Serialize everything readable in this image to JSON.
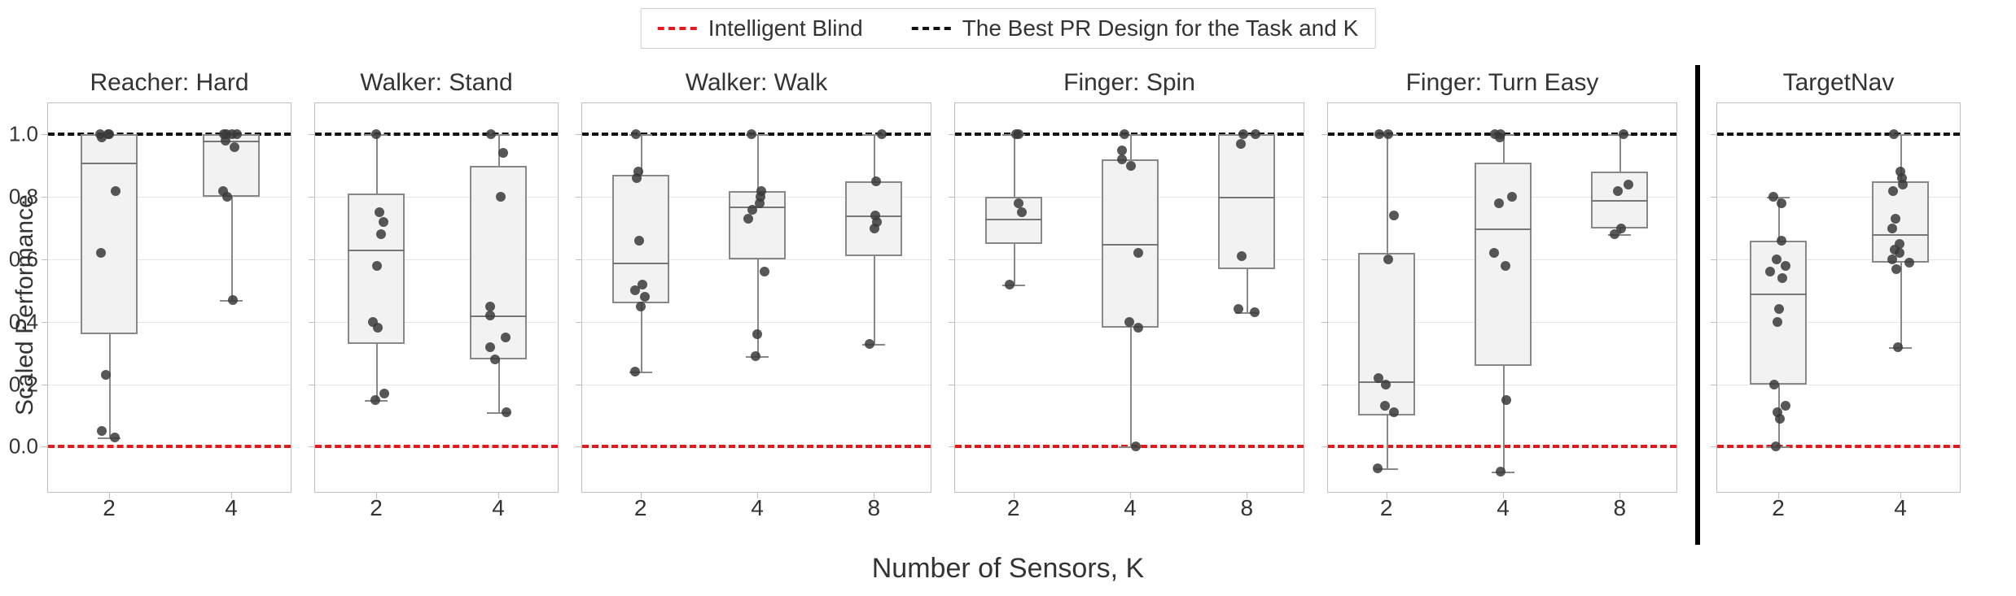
{
  "legend": {
    "blind": "Intelligent Blind",
    "best": "The Best PR Design for the Task and K"
  },
  "ylabel": "Scaled Performance",
  "xlabel": "Number of Sensors, K",
  "yticks": [
    0.0,
    0.2,
    0.4,
    0.6,
    0.8,
    1.0
  ],
  "ylim": [
    -0.15,
    1.1
  ],
  "ref_lines": {
    "black": 1.0,
    "red": 0.0
  },
  "panels": [
    {
      "title": "Reacher: Hard",
      "K": [
        2,
        4
      ],
      "boxes": [
        {
          "q1": 0.36,
          "med": 0.91,
          "q3": 1.0,
          "wlo": 0.03,
          "whi": 1.0
        },
        {
          "q1": 0.8,
          "med": 0.98,
          "q3": 1.0,
          "wlo": 0.47,
          "whi": 1.0
        }
      ],
      "points": [
        [
          0.03,
          0.05,
          0.23,
          0.62,
          0.82,
          0.99,
          1.0,
          1.0,
          1.0
        ],
        [
          0.47,
          0.8,
          0.82,
          0.96,
          0.98,
          1.0,
          1.0,
          1.0,
          1.0
        ]
      ]
    },
    {
      "title": "Walker: Stand",
      "K": [
        2,
        4
      ],
      "boxes": [
        {
          "q1": 0.33,
          "med": 0.63,
          "q3": 0.81,
          "wlo": 0.15,
          "whi": 1.0
        },
        {
          "q1": 0.28,
          "med": 0.42,
          "q3": 0.9,
          "wlo": 0.11,
          "whi": 1.0
        }
      ],
      "points": [
        [
          0.15,
          0.17,
          0.38,
          0.4,
          0.58,
          0.68,
          0.72,
          0.75,
          1.0
        ],
        [
          0.11,
          0.28,
          0.32,
          0.35,
          0.42,
          0.45,
          0.8,
          0.94,
          1.0
        ]
      ]
    },
    {
      "title": "Walker: Walk",
      "K": [
        2,
        4,
        8
      ],
      "boxes": [
        {
          "q1": 0.46,
          "med": 0.59,
          "q3": 0.87,
          "wlo": 0.24,
          "whi": 1.0
        },
        {
          "q1": 0.6,
          "med": 0.77,
          "q3": 0.82,
          "wlo": 0.29,
          "whi": 1.0
        },
        {
          "q1": 0.61,
          "med": 0.74,
          "q3": 0.85,
          "wlo": 0.33,
          "whi": 1.0
        }
      ],
      "points": [
        [
          0.24,
          0.45,
          0.48,
          0.5,
          0.52,
          0.66,
          0.86,
          0.88,
          1.0
        ],
        [
          0.29,
          0.36,
          0.56,
          0.73,
          0.76,
          0.78,
          0.8,
          0.82,
          1.0
        ],
        [
          0.33,
          0.7,
          0.72,
          0.74,
          0.85,
          1.0
        ]
      ]
    },
    {
      "title": "Finger: Spin",
      "K": [
        2,
        4,
        8
      ],
      "boxes": [
        {
          "q1": 0.65,
          "med": 0.73,
          "q3": 0.8,
          "wlo": 0.52,
          "whi": 1.0
        },
        {
          "q1": 0.38,
          "med": 0.65,
          "q3": 0.92,
          "wlo": 0.0,
          "whi": 1.0
        },
        {
          "q1": 0.57,
          "med": 0.8,
          "q3": 1.0,
          "wlo": 0.43,
          "whi": 1.0
        }
      ],
      "points": [
        [
          0.52,
          0.75,
          0.78,
          1.0,
          1.0
        ],
        [
          0.0,
          0.38,
          0.4,
          0.62,
          0.9,
          0.92,
          0.95,
          1.0
        ],
        [
          0.43,
          0.44,
          0.61,
          0.97,
          1.0,
          1.0
        ]
      ]
    },
    {
      "title": "Finger: Turn Easy",
      "K": [
        2,
        4,
        8
      ],
      "boxes": [
        {
          "q1": 0.1,
          "med": 0.21,
          "q3": 0.62,
          "wlo": -0.07,
          "whi": 1.0
        },
        {
          "q1": 0.26,
          "med": 0.7,
          "q3": 0.91,
          "wlo": -0.08,
          "whi": 1.0
        },
        {
          "q1": 0.7,
          "med": 0.79,
          "q3": 0.88,
          "wlo": 0.68,
          "whi": 1.0
        }
      ],
      "points": [
        [
          -0.07,
          0.11,
          0.13,
          0.2,
          0.22,
          0.6,
          0.74,
          1.0,
          1.0
        ],
        [
          -0.08,
          0.15,
          0.58,
          0.62,
          0.78,
          0.8,
          0.99,
          1.0,
          1.0
        ],
        [
          0.68,
          0.7,
          0.82,
          0.84,
          1.0
        ]
      ]
    },
    {
      "title": "TargetNav",
      "K": [
        2,
        4
      ],
      "boxes": [
        {
          "q1": 0.2,
          "med": 0.49,
          "q3": 0.66,
          "wlo": 0.0,
          "whi": 0.8
        },
        {
          "q1": 0.59,
          "med": 0.68,
          "q3": 0.85,
          "wlo": 0.32,
          "whi": 1.0
        }
      ],
      "points": [
        [
          0.0,
          0.09,
          0.11,
          0.13,
          0.2,
          0.4,
          0.44,
          0.54,
          0.56,
          0.58,
          0.6,
          0.66,
          0.78,
          0.8
        ],
        [
          0.32,
          0.57,
          0.59,
          0.6,
          0.62,
          0.63,
          0.65,
          0.7,
          0.73,
          0.82,
          0.84,
          0.86,
          0.88,
          1.0
        ]
      ]
    }
  ],
  "chart_data": {
    "type": "box",
    "ylabel": "Scaled Performance",
    "xlabel": "Number of Sensors, K",
    "ylim": [
      -0.15,
      1.1
    ],
    "reference_lines": [
      {
        "name": "Intelligent Blind",
        "y": 0.0,
        "color": "#e31a1c",
        "style": "dashed"
      },
      {
        "name": "The Best PR Design for the Task and K",
        "y": 1.0,
        "color": "#111111",
        "style": "dashed"
      }
    ],
    "facets": [
      {
        "title": "Reacher: Hard",
        "x": [
          2,
          4
        ],
        "series": [
          {
            "K": 2,
            "box": {
              "q1": 0.36,
              "median": 0.91,
              "q3": 1.0,
              "whisker_low": 0.03,
              "whisker_high": 1.0
            },
            "points": [
              0.03,
              0.05,
              0.23,
              0.62,
              0.82,
              0.99,
              1.0,
              1.0,
              1.0
            ]
          },
          {
            "K": 4,
            "box": {
              "q1": 0.8,
              "median": 0.98,
              "q3": 1.0,
              "whisker_low": 0.47,
              "whisker_high": 1.0
            },
            "points": [
              0.47,
              0.8,
              0.82,
              0.96,
              0.98,
              1.0,
              1.0,
              1.0,
              1.0
            ]
          }
        ]
      },
      {
        "title": "Walker: Stand",
        "x": [
          2,
          4
        ],
        "series": [
          {
            "K": 2,
            "box": {
              "q1": 0.33,
              "median": 0.63,
              "q3": 0.81,
              "whisker_low": 0.15,
              "whisker_high": 1.0
            },
            "points": [
              0.15,
              0.17,
              0.38,
              0.4,
              0.58,
              0.68,
              0.72,
              0.75,
              1.0
            ]
          },
          {
            "K": 4,
            "box": {
              "q1": 0.28,
              "median": 0.42,
              "q3": 0.9,
              "whisker_low": 0.11,
              "whisker_high": 1.0
            },
            "points": [
              0.11,
              0.28,
              0.32,
              0.35,
              0.42,
              0.45,
              0.8,
              0.94,
              1.0
            ]
          }
        ]
      },
      {
        "title": "Walker: Walk",
        "x": [
          2,
          4,
          8
        ],
        "series": [
          {
            "K": 2,
            "box": {
              "q1": 0.46,
              "median": 0.59,
              "q3": 0.87,
              "whisker_low": 0.24,
              "whisker_high": 1.0
            },
            "points": [
              0.24,
              0.45,
              0.48,
              0.5,
              0.52,
              0.66,
              0.86,
              0.88,
              1.0
            ]
          },
          {
            "K": 4,
            "box": {
              "q1": 0.6,
              "median": 0.77,
              "q3": 0.82,
              "whisker_low": 0.29,
              "whisker_high": 1.0
            },
            "points": [
              0.29,
              0.36,
              0.56,
              0.73,
              0.76,
              0.78,
              0.8,
              0.82,
              1.0
            ]
          },
          {
            "K": 8,
            "box": {
              "q1": 0.61,
              "median": 0.74,
              "q3": 0.85,
              "whisker_low": 0.33,
              "whisker_high": 1.0
            },
            "points": [
              0.33,
              0.7,
              0.72,
              0.74,
              0.85,
              1.0
            ]
          }
        ]
      },
      {
        "title": "Finger: Spin",
        "x": [
          2,
          4,
          8
        ],
        "series": [
          {
            "K": 2,
            "box": {
              "q1": 0.65,
              "median": 0.73,
              "q3": 0.8,
              "whisker_low": 0.52,
              "whisker_high": 1.0
            },
            "points": [
              0.52,
              0.75,
              0.78,
              1.0,
              1.0
            ]
          },
          {
            "K": 4,
            "box": {
              "q1": 0.38,
              "median": 0.65,
              "q3": 0.92,
              "whisker_low": 0.0,
              "whisker_high": 1.0
            },
            "points": [
              0.0,
              0.38,
              0.4,
              0.62,
              0.9,
              0.92,
              0.95,
              1.0
            ]
          },
          {
            "K": 8,
            "box": {
              "q1": 0.57,
              "median": 0.8,
              "q3": 1.0,
              "whisker_low": 0.43,
              "whisker_high": 1.0
            },
            "points": [
              0.43,
              0.44,
              0.61,
              0.97,
              1.0,
              1.0
            ]
          }
        ]
      },
      {
        "title": "Finger: Turn Easy",
        "x": [
          2,
          4,
          8
        ],
        "series": [
          {
            "K": 2,
            "box": {
              "q1": 0.1,
              "median": 0.21,
              "q3": 0.62,
              "whisker_low": -0.07,
              "whisker_high": 1.0
            },
            "points": [
              -0.07,
              0.11,
              0.13,
              0.2,
              0.22,
              0.6,
              0.74,
              1.0,
              1.0
            ]
          },
          {
            "K": 4,
            "box": {
              "q1": 0.26,
              "median": 0.7,
              "q3": 0.91,
              "whisker_low": -0.08,
              "whisker_high": 1.0
            },
            "points": [
              -0.08,
              0.15,
              0.58,
              0.62,
              0.78,
              0.8,
              0.99,
              1.0,
              1.0
            ]
          },
          {
            "K": 8,
            "box": {
              "q1": 0.7,
              "median": 0.79,
              "q3": 0.88,
              "whisker_low": 0.68,
              "whisker_high": 1.0
            },
            "points": [
              0.68,
              0.7,
              0.82,
              0.84,
              1.0
            ]
          }
        ]
      },
      {
        "title": "TargetNav",
        "x": [
          2,
          4
        ],
        "series": [
          {
            "K": 2,
            "box": {
              "q1": 0.2,
              "median": 0.49,
              "q3": 0.66,
              "whisker_low": 0.0,
              "whisker_high": 0.8
            },
            "points": [
              0.0,
              0.09,
              0.11,
              0.13,
              0.2,
              0.4,
              0.44,
              0.54,
              0.56,
              0.58,
              0.6,
              0.66,
              0.78,
              0.8
            ]
          },
          {
            "K": 4,
            "box": {
              "q1": 0.59,
              "median": 0.68,
              "q3": 0.85,
              "whisker_low": 0.32,
              "whisker_high": 1.0
            },
            "points": [
              0.32,
              0.57,
              0.59,
              0.6,
              0.62,
              0.63,
              0.65,
              0.7,
              0.73,
              0.82,
              0.84,
              0.86,
              0.88,
              1.0
            ]
          }
        ]
      }
    ]
  }
}
